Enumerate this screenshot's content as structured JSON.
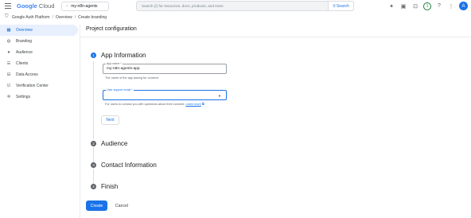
{
  "topbar": {
    "logo": {
      "google": "Google",
      "cloud": " Cloud"
    },
    "project": "my-n8n-agents",
    "search_placeholder": "Search (/) for resources, docs, products, and more",
    "search_button": "Search",
    "badge_count": "1",
    "avatar_initial": "A"
  },
  "breadcrumb": {
    "items": [
      "Google Auth Platform",
      "Overview",
      "Create branding"
    ],
    "separator": "/"
  },
  "sidebar": {
    "items": [
      {
        "label": "Overview",
        "icon": "grid-icon",
        "active": true
      },
      {
        "label": "Branding",
        "icon": "palette-icon"
      },
      {
        "label": "Audience",
        "icon": "people-icon"
      },
      {
        "label": "Clients",
        "icon": "clients-icon"
      },
      {
        "label": "Data Access",
        "icon": "data-access-icon"
      },
      {
        "label": "Verification Center",
        "icon": "verification-icon"
      },
      {
        "label": "Settings",
        "icon": "gear-icon"
      }
    ]
  },
  "page": {
    "title": "Project configuration"
  },
  "steps": [
    {
      "num": "1",
      "label": "App Information"
    },
    {
      "num": "2",
      "label": "Audience"
    },
    {
      "num": "3",
      "label": "Contact Information"
    },
    {
      "num": "4",
      "label": "Finish"
    }
  ],
  "form": {
    "app_name": {
      "label": "App name *",
      "value": "my-n8n-agents-app",
      "hint": "The name of the app asking for consent"
    },
    "support_email": {
      "label": "User support email *",
      "value": "",
      "hint": "For users to contact you with questions about their consent.",
      "hint_link": "Learn more"
    },
    "next_button": "Next"
  },
  "footer": {
    "create_button": "Create",
    "cancel_button": "Cancel"
  },
  "colors": {
    "accent": "#1a73e8",
    "active_bg": "#e8f0fe"
  }
}
